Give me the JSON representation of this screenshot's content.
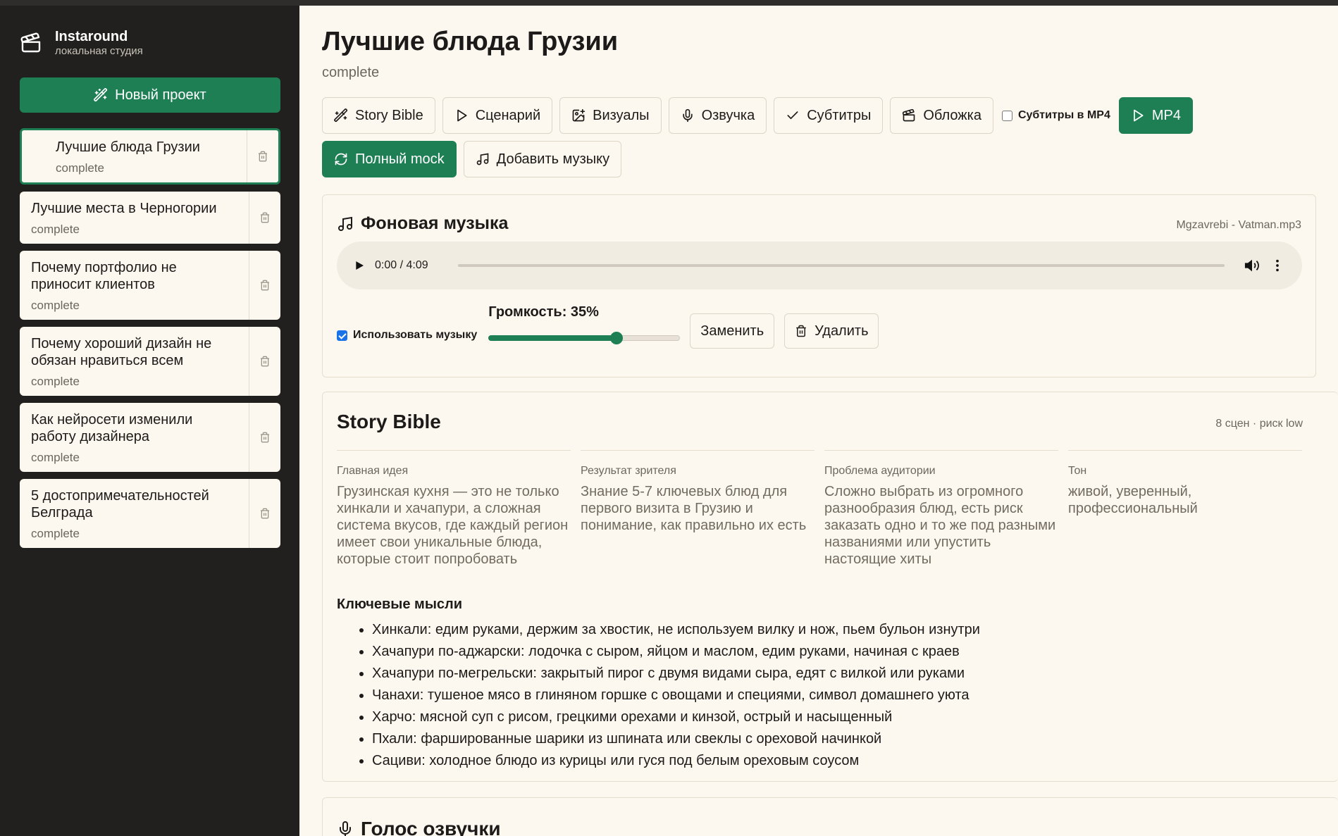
{
  "sidebar": {
    "brand_name": "Instaround",
    "brand_sub": "локальная студия",
    "new_project_label": "Новый проект",
    "projects": [
      {
        "title": "Лучшие блюда Грузии",
        "status": "complete"
      },
      {
        "title": "Лучшие места в Черногории",
        "status": "complete"
      },
      {
        "title": "Почему портфолио не приносит клиентов",
        "status": "complete"
      },
      {
        "title": "Почему хороший дизайн не обязан нравиться всем",
        "status": "complete"
      },
      {
        "title": "Как нейросети изменили работу дизайнера",
        "status": "complete"
      },
      {
        "title": "5 достопримечательностей Белграда",
        "status": "complete"
      }
    ]
  },
  "main": {
    "title": "Лучшие блюда Грузии",
    "status": "complete",
    "toolbar": {
      "story_bible": "Story Bible",
      "script": "Сценарий",
      "visuals": "Визуалы",
      "voiceover": "Озвучка",
      "subtitles": "Субтитры",
      "cover": "Обложка",
      "subs_in_mp4": "Субтитры в MP4",
      "mp4": "MP4",
      "full_mock": "Полный mock",
      "add_music": "Добавить музыку"
    },
    "music": {
      "title": "Фоновая музыка",
      "file": "Mgzavrebi - Vatman.mp3",
      "time": "0:00 / 4:09",
      "use_music_label": "Использовать музыку",
      "volume_label": "Громкость: 35%",
      "volume_fraction": 0.67,
      "replace_label": "Заменить",
      "delete_label": "Удалить"
    },
    "story_bible": {
      "title": "Story Bible",
      "meta": "8 сцен · риск low",
      "columns": [
        {
          "label": "Главная идея",
          "text": "Грузинская кухня — это не только хинкали и хачапури, а сложная система вкусов, где каждый регион имеет свои уникальные блюда, которые стоит попробовать"
        },
        {
          "label": "Результат зрителя",
          "text": "Знание 5-7 ключевых блюд для первого визита в Грузию и понимание, как правильно их есть"
        },
        {
          "label": "Проблема аудитории",
          "text": "Сложно выбрать из огромного разнообразия блюд, есть риск заказать одно и то же под разными названиями или упустить настоящие хиты"
        },
        {
          "label": "Тон",
          "text": "живой, уверенный, профессиональный"
        }
      ],
      "key_thoughts_title": "Ключевые мысли",
      "key_thoughts": [
        "Хинкали: едим руками, держим за хвостик, не используем вилку и нож, пьем бульон изнутри",
        "Хачапури по-аджарски: лодочка с сыром, яйцом и маслом, едим руками, начиная с краев",
        "Хачапури по-мегрельски: закрытый пирог с двумя видами сыра, едят с вилкой или руками",
        "Чанахи: тушеное мясо в глиняном горшке с овощами и специями, символ домашнего уюта",
        "Харчо: мясной суп с рисом, грецкими орехами и кинзой, острый и насыщенный",
        "Пхали: фаршированные шарики из шпината или свеклы с ореховой начинкой",
        "Сациви: холодное блюдо из курицы или гуся под белым ореховым соусом"
      ]
    },
    "voice": {
      "title": "Голос озвучки"
    }
  }
}
